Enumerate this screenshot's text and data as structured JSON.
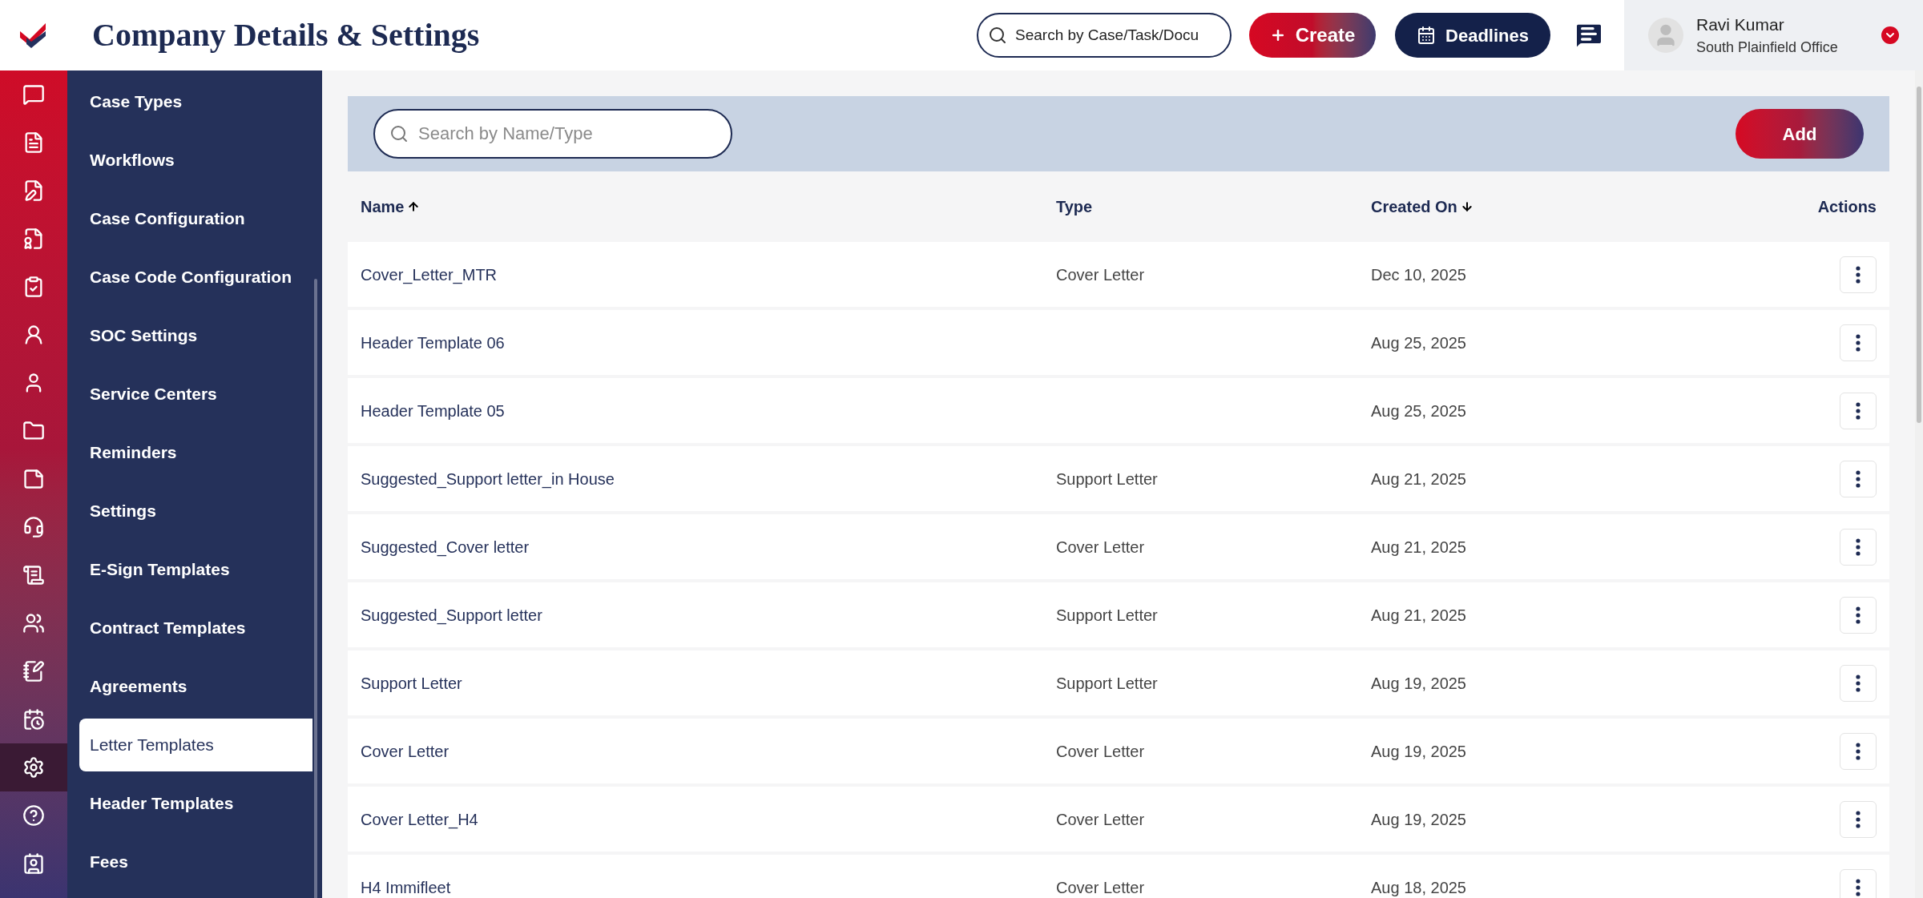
{
  "header": {
    "title": "Company Details & Settings",
    "search": {
      "placeholder": "Search by Case/Task/Docu"
    },
    "create_button": "Create",
    "deadlines_button": "Deadlines",
    "user": {
      "name": "Ravi Kumar",
      "office": "South Plainfield Office"
    }
  },
  "rail_items": [
    {
      "selected": false
    },
    {
      "selected": false
    },
    {
      "selected": false
    },
    {
      "selected": false
    },
    {
      "selected": false
    },
    {
      "selected": false
    },
    {
      "selected": false
    },
    {
      "selected": false
    },
    {
      "selected": false
    },
    {
      "selected": false
    },
    {
      "selected": false
    },
    {
      "selected": false
    },
    {
      "selected": false
    },
    {
      "selected": false
    },
    {
      "selected": true
    },
    {
      "selected": false
    },
    {
      "selected": false
    }
  ],
  "sidebar": {
    "items": [
      {
        "label": "Case Types",
        "selected": false
      },
      {
        "label": "Workflows",
        "selected": false
      },
      {
        "label": "Case Configuration",
        "selected": false
      },
      {
        "label": "Case Code Configuration",
        "selected": false
      },
      {
        "label": "SOC Settings",
        "selected": false
      },
      {
        "label": "Service Centers",
        "selected": false
      },
      {
        "label": "Reminders",
        "selected": false
      },
      {
        "label": "Settings",
        "selected": false
      },
      {
        "label": "E-Sign Templates",
        "selected": false
      },
      {
        "label": "Contract Templates",
        "selected": false
      },
      {
        "label": "Agreements",
        "selected": false
      },
      {
        "label": "Letter Templates",
        "selected": true
      },
      {
        "label": "Header Templates",
        "selected": false
      },
      {
        "label": "Fees",
        "selected": false
      }
    ]
  },
  "toolbar": {
    "search": {
      "placeholder": "Search by Name/Type"
    },
    "add_button": "Add"
  },
  "table": {
    "columns": [
      {
        "label": "Name",
        "sorted_asc": true,
        "sorted_desc": false
      },
      {
        "label": "Type",
        "sorted_asc": false,
        "sorted_desc": false
      },
      {
        "label": "Created On",
        "sorted_asc": false,
        "sorted_desc": true
      },
      {
        "label": "Actions",
        "sorted_asc": false,
        "sorted_desc": false
      }
    ],
    "rows": [
      {
        "name": "Cover_Letter_MTR",
        "type": "Cover Letter",
        "created": "Dec 10, 2025"
      },
      {
        "name": "Header Template 06",
        "created": "Aug 25, 2025"
      },
      {
        "name": "Header Template 05",
        "created": "Aug 25, 2025"
      },
      {
        "name": "Suggested_Support letter_in House",
        "type": "Support Letter",
        "created": "Aug 21, 2025"
      },
      {
        "name": "Suggested_Cover letter",
        "type": "Cover Letter",
        "created": "Aug 21, 2025"
      },
      {
        "name": "Suggested_Support letter",
        "type": "Support Letter",
        "created": "Aug 21, 2025"
      },
      {
        "name": "Support Letter",
        "type": "Support Letter",
        "created": "Aug 19, 2025"
      },
      {
        "name": "Cover Letter",
        "type": "Cover Letter",
        "created": "Aug 19, 2025"
      },
      {
        "name": "Cover Letter_H4",
        "type": "Cover Letter",
        "created": "Aug 19, 2025"
      },
      {
        "name": "H4 Immifleet",
        "type": "Cover Letter",
        "created": "Aug 18, 2025"
      }
    ]
  }
}
